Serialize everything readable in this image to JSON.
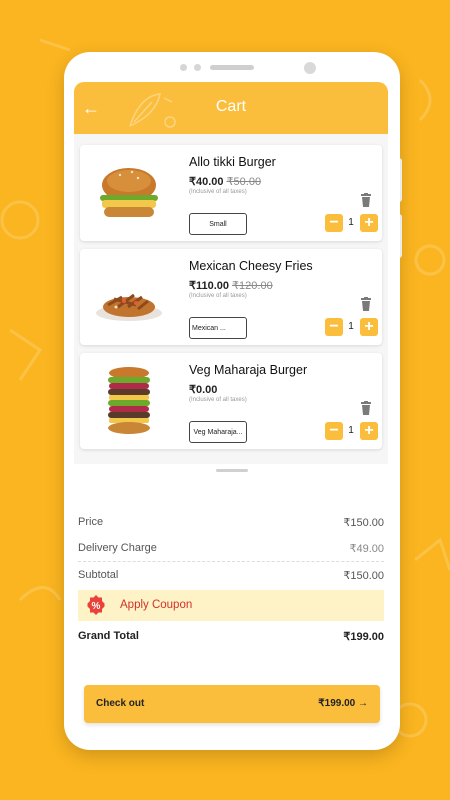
{
  "header": {
    "title": "Cart",
    "back_icon": "arrow-left-icon"
  },
  "cart_items": [
    {
      "name": "Allo tikki Burger",
      "price": "₹40.00",
      "old_price": "₹50.00",
      "tax_note": "(Inclusive of all taxes)",
      "variant": "Small",
      "quantity": "1",
      "image": "burger-image"
    },
    {
      "name": "Mexican Cheesy Fries",
      "price": "₹110.00",
      "old_price": "₹120.00",
      "tax_note": "(Inclusive of all taxes)",
      "variant": "Mexican ...",
      "quantity": "1",
      "image": "fries-image"
    },
    {
      "name": "Veg Maharaja Burger",
      "price": "₹0.00",
      "old_price": "",
      "tax_note": "(Inclusive of all taxes)",
      "variant": "Veg Maharaja...",
      "quantity": "1",
      "image": "tall-burger-image"
    }
  ],
  "summary": {
    "price_label": "Price",
    "price_value": "₹150.00",
    "delivery_label": "Delivery Charge",
    "delivery_value": "₹49.00",
    "subtotal_label": "Subtotal",
    "subtotal_value": "₹150.00",
    "coupon_label": "Apply Coupon",
    "grand_total_label": "Grand Total",
    "grand_total_value": "₹199.00"
  },
  "checkout": {
    "label": "Check out",
    "total": "₹199.00"
  },
  "colors": {
    "accent": "#FBBE3C",
    "background": "#FBB520",
    "coupon_bg": "#FDF3C6",
    "coupon_text": "#D2312A"
  }
}
